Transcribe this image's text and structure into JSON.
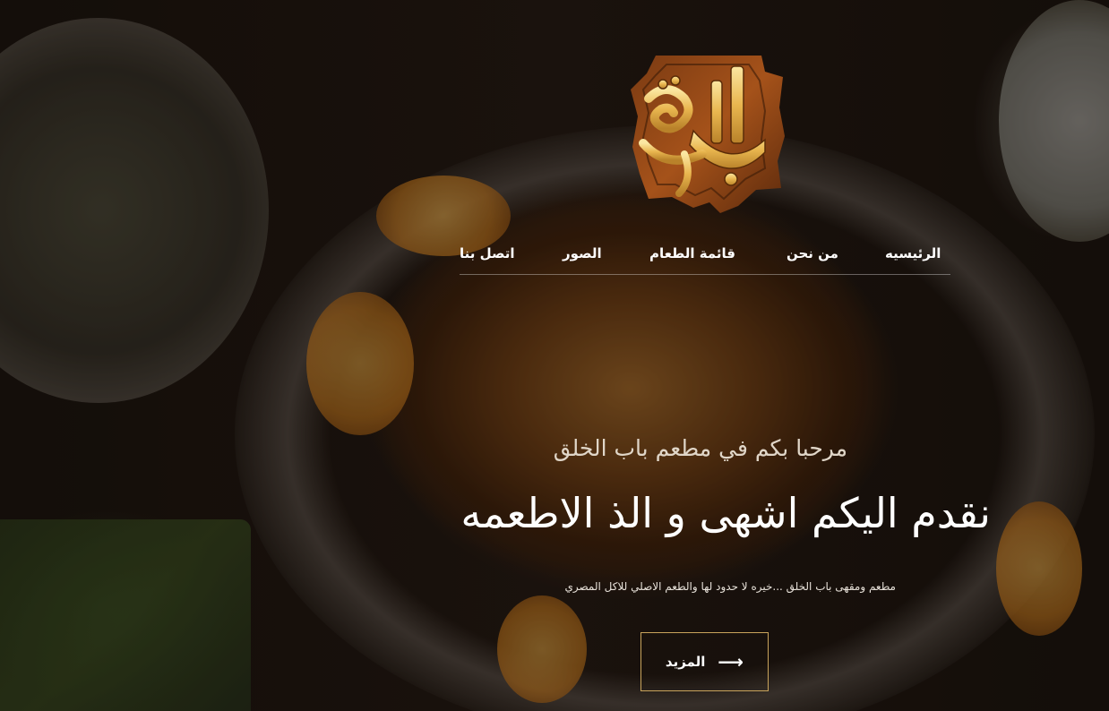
{
  "logo": {
    "text": "باب الخلق",
    "icon": "restaurant-logo-icon"
  },
  "nav": {
    "items": [
      {
        "label": "الرئيسيه"
      },
      {
        "label": "من نحن"
      },
      {
        "label": "قائمة الطعام"
      },
      {
        "label": "الصور"
      },
      {
        "label": "اتصل بنا"
      }
    ]
  },
  "hero": {
    "welcome": "مرحبا بكم في مطعم باب الخلق",
    "headline": "نقدم اليكم اشهى و الذ الاطعمه",
    "subtitle": "مطعم ومقهى باب الخلق ...خيره لا حدود لها والطعم الاصلي للاكل المصري",
    "button_label": "المزيد",
    "button_icon": "arrow-right-icon"
  },
  "colors": {
    "accent": "#c9a45c",
    "text": "#ffffff"
  }
}
